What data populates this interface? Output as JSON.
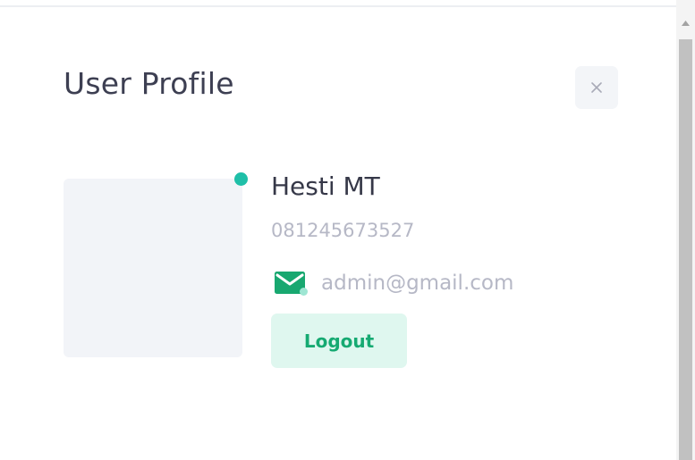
{
  "profile": {
    "title": "User Profile",
    "name": "Hesti MT",
    "phone": "081245673527",
    "email": "admin@gmail.com",
    "logout_label": "Logout",
    "online": true
  },
  "icons": {
    "close": "close-icon",
    "mail": "mail-icon",
    "scroll_up": "scroll-up-arrow-icon"
  },
  "colors": {
    "accent": "#16aa72",
    "accent_bg": "#dff7ef",
    "status_online": "#1fbfa8",
    "muted_text": "#b6b8c6",
    "title_text": "#3d3f52"
  }
}
